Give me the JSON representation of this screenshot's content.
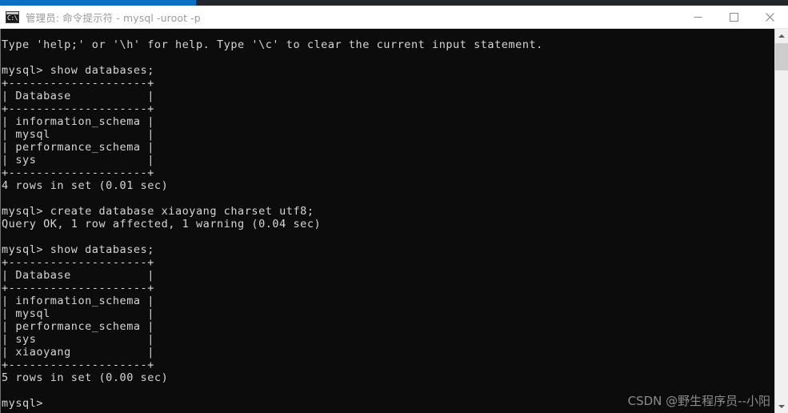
{
  "window": {
    "title": "管理员: 命令提示符 - mysql  -uroot -p",
    "icon_name": "cmd-icon",
    "icon_glyph": "C:\\",
    "accent_color": "#0b6fc4",
    "titlebar_background": "#ffffff",
    "console_background": "#0c0c0c",
    "console_foreground": "#d6d6d6",
    "controls": {
      "minimize_label": "—",
      "maximize_label": "□",
      "close_label": "✕"
    }
  },
  "scrollbar": {
    "up_label": "▲",
    "down_label": "▼",
    "thumb_name": "scrollbar-thumb"
  },
  "console": {
    "lines": [
      "Type 'help;' or '\\h' for help. Type '\\c' to clear the current input statement.",
      "",
      "mysql> show databases;",
      "+--------------------+",
      "| Database           |",
      "+--------------------+",
      "| information_schema |",
      "| mysql              |",
      "| performance_schema |",
      "| sys                |",
      "+--------------------+",
      "4 rows in set (0.01 sec)",
      "",
      "mysql> create database xiaoyang charset utf8;",
      "Query OK, 1 row affected, 1 warning (0.04 sec)",
      "",
      "mysql> show databases;",
      "+--------------------+",
      "| Database           |",
      "+--------------------+",
      "| information_schema |",
      "| mysql              |",
      "| performance_schema |",
      "| sys                |",
      "| xiaoyang           |",
      "+--------------------+",
      "5 rows in set (0.00 sec)",
      "",
      "mysql>"
    ],
    "prompt": "mysql>"
  },
  "watermark": {
    "text": "CSDN @野生程序员--小阳"
  }
}
